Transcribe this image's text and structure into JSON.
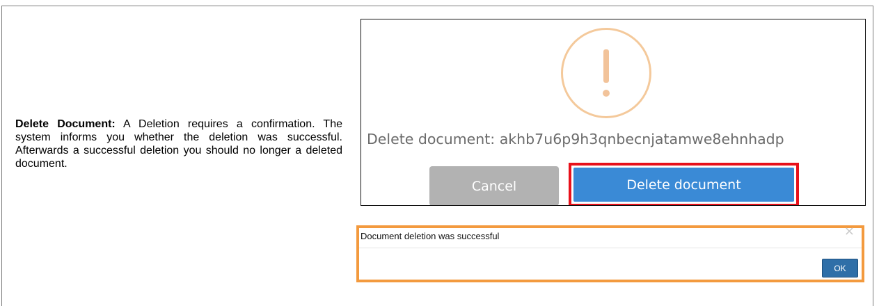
{
  "description": {
    "heading": "Delete Document:",
    "text": " A Deletion requires a confirmation. The system informs you whether the deletion was successful. Afterwards a successful deletion you should no longer a deleted document."
  },
  "confirm_dialog": {
    "icon": "warning-icon",
    "icon_glyph": "!",
    "message": "Delete document: akhb7u6p9h3qnbecnjatamwe8ehnhadp",
    "cancel_label": "Cancel",
    "delete_label": "Delete document"
  },
  "alert": {
    "message": "Document deletion was successful",
    "close_glyph": "×",
    "ok_label": "OK"
  },
  "colors": {
    "highlight_red": "#e8111b",
    "highlight_orange": "#f39a3e",
    "primary_blue": "#3a8ad6",
    "cancel_gray": "#b2b2b2",
    "warning_orange": "#f4c99b"
  }
}
